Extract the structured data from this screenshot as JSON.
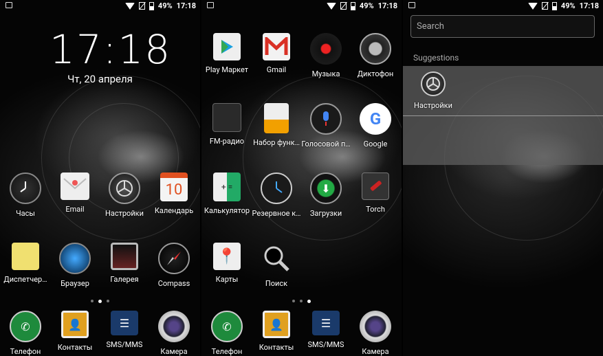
{
  "status": {
    "battery": "49%",
    "time": "17:18"
  },
  "lock": {
    "clock": "17:18",
    "date": "Чт, 20 апреля"
  },
  "screen1": {
    "apps": [
      {
        "name": "clock",
        "label": "Часы"
      },
      {
        "name": "email",
        "label": "Email"
      },
      {
        "name": "settings",
        "label": "Настройки"
      },
      {
        "name": "calendar",
        "label": "Календарь",
        "icon_text": "10"
      },
      {
        "name": "file-manager",
        "label": "Диспетчер…"
      },
      {
        "name": "browser",
        "label": "Браузер"
      },
      {
        "name": "gallery",
        "label": "Галерея"
      },
      {
        "name": "compass",
        "label": "Compass"
      }
    ]
  },
  "screen2": {
    "apps": [
      {
        "name": "play-market",
        "label": "Play Маркет"
      },
      {
        "name": "gmail",
        "label": "Gmail"
      },
      {
        "name": "music",
        "label": "Музыка"
      },
      {
        "name": "recorder",
        "label": "Диктофон"
      },
      {
        "name": "fm-radio",
        "label": "FM-радио"
      },
      {
        "name": "dialer-pad",
        "label": "Набор функ…"
      },
      {
        "name": "voice-search",
        "label": "Голосовой п…"
      },
      {
        "name": "google",
        "label": "Google"
      },
      {
        "name": "calculator",
        "label": "Калькулятор"
      },
      {
        "name": "backup",
        "label": "Резервное к…"
      },
      {
        "name": "downloads",
        "label": "Загрузки"
      },
      {
        "name": "torch",
        "label": "Torch"
      },
      {
        "name": "maps",
        "label": "Карты"
      },
      {
        "name": "search",
        "label": "Поиск"
      }
    ]
  },
  "dock": [
    {
      "name": "phone",
      "label": "Телефон"
    },
    {
      "name": "contacts",
      "label": "Контакты"
    },
    {
      "name": "sms",
      "label": "SMS/MMS"
    },
    {
      "name": "camera",
      "label": "Камера"
    }
  ],
  "screen3": {
    "search_placeholder": "Search",
    "suggestions_title": "Suggestions",
    "suggestion_label": "Настройки"
  },
  "colors": {
    "phone": "#1e8a3c",
    "contacts": "#e0a020",
    "sms": "#1a3a6a",
    "gmail": "#d93025",
    "google": "#4285f4"
  }
}
